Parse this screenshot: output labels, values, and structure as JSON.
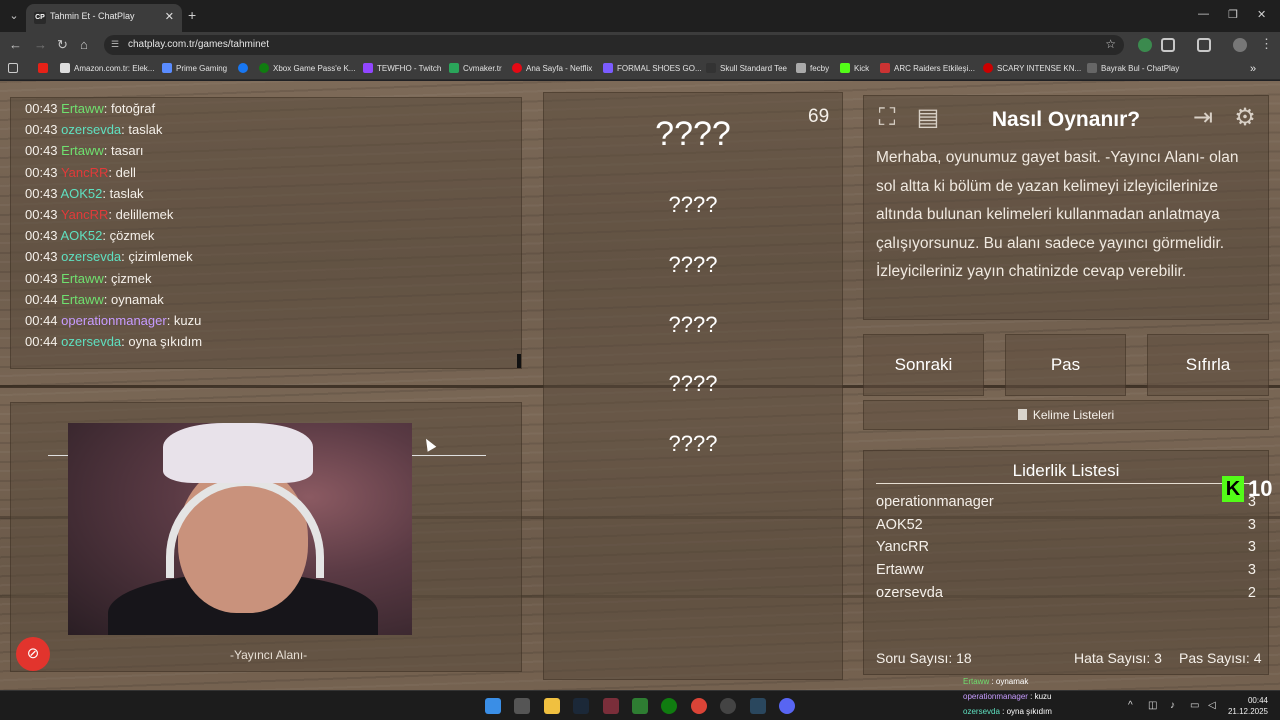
{
  "browser": {
    "tab_title": "Tahmin Et - ChatPlay",
    "tab_favicon": "CP",
    "url": "chatplay.com.tr/games/tahminet",
    "bookmarks": [
      "Amazon.com.tr: Elek...",
      "Prime Gaming",
      "Xbox Game Pass'e K...",
      "TEWFHO - Twitch",
      "Cvmaker.tr",
      "Ana Sayfa - Netflix",
      "FORMAL SHOES GO...",
      "Skull Standard Tee",
      "fecby",
      "Kick",
      "ARC Raiders Etkileşi...",
      "SCARY INTENSE KN...",
      "Bayrak Bul - ChatPlay"
    ]
  },
  "chat": {
    "messages": [
      {
        "time": "00:43",
        "user": "Ertaww",
        "text": ": fotoğraf"
      },
      {
        "time": "00:43",
        "user": "ozersevda",
        "text": ": taslak"
      },
      {
        "time": "00:43",
        "user": "Ertaww",
        "text": ": tasarı"
      },
      {
        "time": "00:43",
        "user": "YancRR",
        "text": ": dell"
      },
      {
        "time": "00:43",
        "user": "AOK52",
        "text": ": taslak"
      },
      {
        "time": "00:43",
        "user": "YancRR",
        "text": ": delillemek"
      },
      {
        "time": "00:43",
        "user": "AOK52",
        "text": ": çözmek"
      },
      {
        "time": "00:43",
        "user": "ozersevda",
        "text": ": çizimlemek"
      },
      {
        "time": "00:43",
        "user": "Ertaww",
        "text": ": çizmek"
      },
      {
        "time": "00:44",
        "user": "Ertaww",
        "text": ": oynamak"
      },
      {
        "time": "00:44",
        "user": "operationmanager",
        "text": ": kuzu"
      },
      {
        "time": "00:44",
        "user": "ozersevda",
        "text": ": oyna şıkıdım"
      }
    ]
  },
  "streamer": {
    "caption": "-Yayıncı Alanı-"
  },
  "game": {
    "counter": "69",
    "words": [
      "????",
      "????",
      "????",
      "????",
      "????",
      "????"
    ]
  },
  "help": {
    "title": "Nasıl Oynanır?",
    "text": "Merhaba, oyunumuz gayet basit. -Yayıncı Alanı- olan sol altta ki bölüm de yazan kelimeyi izleyicilerinize altında bulunan kelimeleri kullanmadan anlatmaya çalışıyorsunuz. Bu alanı sadece yayıncı görmelidir. İzleyicileriniz yayın chatinizde cevap verebilir."
  },
  "actions": {
    "next": "Sonraki",
    "pass": "Pas",
    "reset": "Sıfırla",
    "word_lists": "Kelime Listeleri"
  },
  "leaderboard": {
    "title": "Liderlik Listesi",
    "rows": [
      {
        "name": "operationmanager",
        "score": "3"
      },
      {
        "name": "AOK52",
        "score": "3"
      },
      {
        "name": "YancRR",
        "score": "3"
      },
      {
        "name": "Ertaww",
        "score": "3"
      },
      {
        "name": "ozersevda",
        "score": "2"
      }
    ]
  },
  "kick_badge": {
    "letter": "K",
    "count": "10"
  },
  "stats": {
    "questions": "Soru Sayısı: 18",
    "errors": "Hata Sayısı: 3",
    "passes": "Pas Sayısı: 4"
  },
  "overlay_chat": [
    {
      "user": "Ertaww",
      "text": " : oynamak"
    },
    {
      "user": "operationmanager",
      "text": " : kuzu"
    },
    {
      "user": "ozersevda",
      "text": " : oyna şıkıdım"
    }
  ],
  "clock": {
    "time": "00:44",
    "date": "21.12.2025"
  }
}
